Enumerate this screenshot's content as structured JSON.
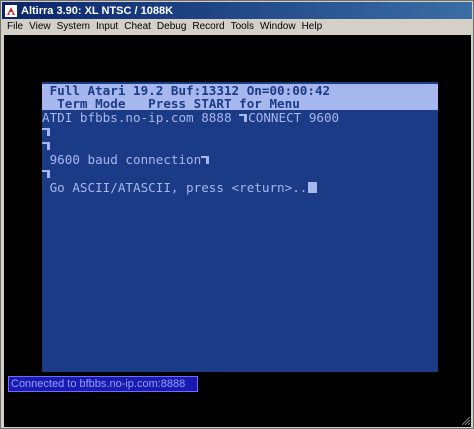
{
  "window": {
    "title": "Altirra 3.90: XL NTSC / 1088K",
    "icon": "altirra-app-icon"
  },
  "menu": {
    "items": [
      "File",
      "View",
      "System",
      "Input",
      "Cheat",
      "Debug",
      "Record",
      "Tools",
      "Window",
      "Help"
    ]
  },
  "terminal": {
    "status_line_1": " Full Atari 19.2 Buf:13312 On=00:00:42",
    "status_line_2": "  Term Mode   Press START for Menu",
    "lines": [
      "ATDI bfbbs.no-ip.com 8888",
      "CONNECT 9600",
      "",
      " 9600 baud connection",
      "",
      " Go ASCII/ATASCII, press <return>.."
    ]
  },
  "overlay": {
    "message": "Connected to bfbbs.no-ip.com:8888"
  },
  "colors": {
    "screen_bg": "#1c3b86",
    "screen_fg": "#a6b7ee",
    "titlebar_start": "#0a246a",
    "titlebar_end": "#3a6ea5",
    "overlay_bg": "#1a1ab0"
  }
}
